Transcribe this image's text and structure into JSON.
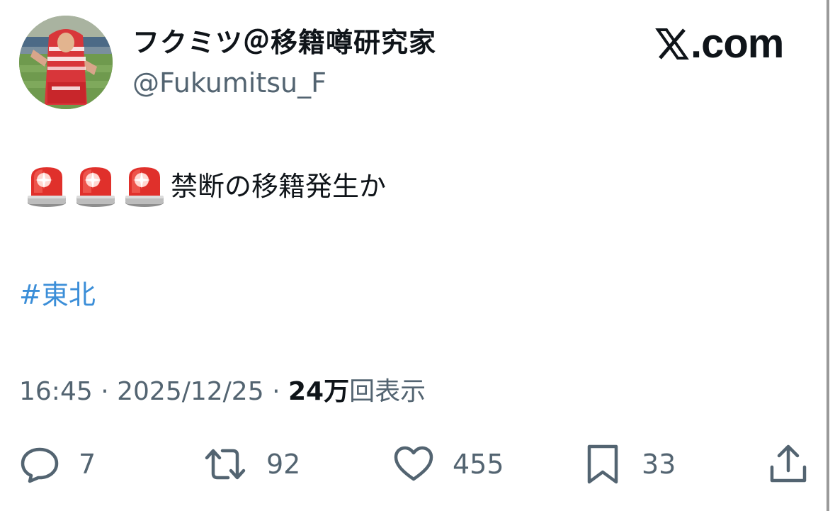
{
  "author": {
    "display_name": "フクミツ＠移籍噂研究家",
    "handle": "@Fukumitsu_F"
  },
  "brand": {
    "logo_icon": "x-logo-icon",
    "label": ".com"
  },
  "tweet": {
    "emoji": [
      "police-car-light-icon",
      "police-car-light-icon",
      "police-car-light-icon"
    ],
    "text": "禁断の移籍発生か",
    "hashtag": "#東北"
  },
  "meta": {
    "time": "16:45",
    "separator": "·",
    "date": "2025/12/25",
    "views_count": "24万",
    "views_label": "回表示"
  },
  "actions": {
    "replies": "7",
    "reposts": "92",
    "likes": "455",
    "bookmarks": "33"
  },
  "colors": {
    "text": "#0f1419",
    "secondary": "#536471",
    "link": "#3b8ed8"
  }
}
